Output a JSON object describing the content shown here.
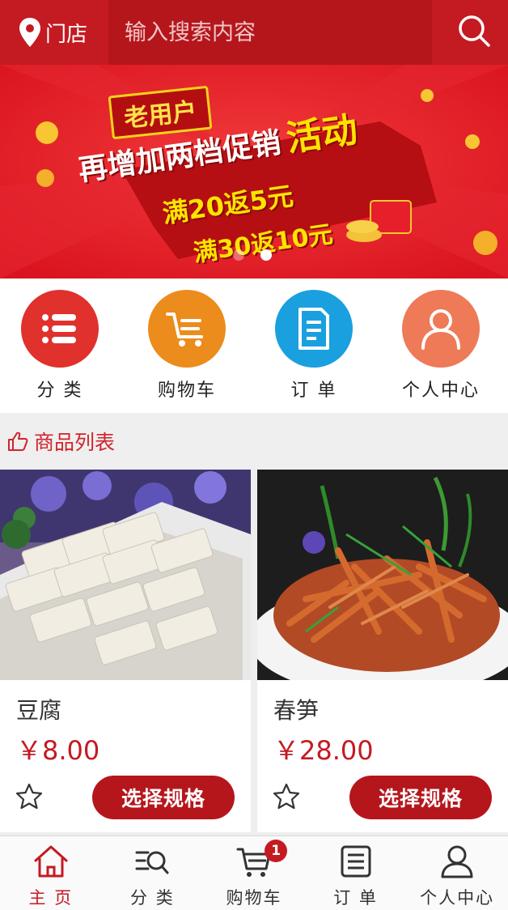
{
  "header": {
    "store_label": "门店",
    "search_placeholder": "输入搜索内容",
    "brand_color": "#c41a22"
  },
  "banner": {
    "tag": "老用户",
    "headline": "再增加两档促销",
    "headline_highlight": "活动",
    "line1": "满20返5元",
    "line2": "满30返10元",
    "slides": 2,
    "active_slide": 2
  },
  "quicknav": [
    {
      "label": "分 类",
      "icon": "list-icon",
      "color": "#e0312c"
    },
    {
      "label": "购物车",
      "icon": "cart-icon",
      "color": "#ec8c1d"
    },
    {
      "label": "订 单",
      "icon": "document-icon",
      "color": "#1aa0df"
    },
    {
      "label": "个人中心",
      "icon": "user-icon",
      "color": "#ee7a58"
    }
  ],
  "section": {
    "title": "商品列表",
    "icon": "thumbs-up-icon"
  },
  "products": [
    {
      "name": "豆腐",
      "price": "￥8.00",
      "button": "选择规格",
      "image": "tofu-photo"
    },
    {
      "name": "春笋",
      "price": "￥28.00",
      "button": "选择规格",
      "image": "bamboo-shoots-photo"
    }
  ],
  "tabbar": [
    {
      "label": "主 页",
      "icon": "home-icon",
      "active": true
    },
    {
      "label": "分 类",
      "icon": "category-search-icon",
      "active": false
    },
    {
      "label": "购物车",
      "icon": "cart-icon",
      "active": false,
      "badge": "1"
    },
    {
      "label": "订 单",
      "icon": "order-icon",
      "active": false
    },
    {
      "label": "个人中心",
      "icon": "user-icon",
      "active": false
    }
  ]
}
